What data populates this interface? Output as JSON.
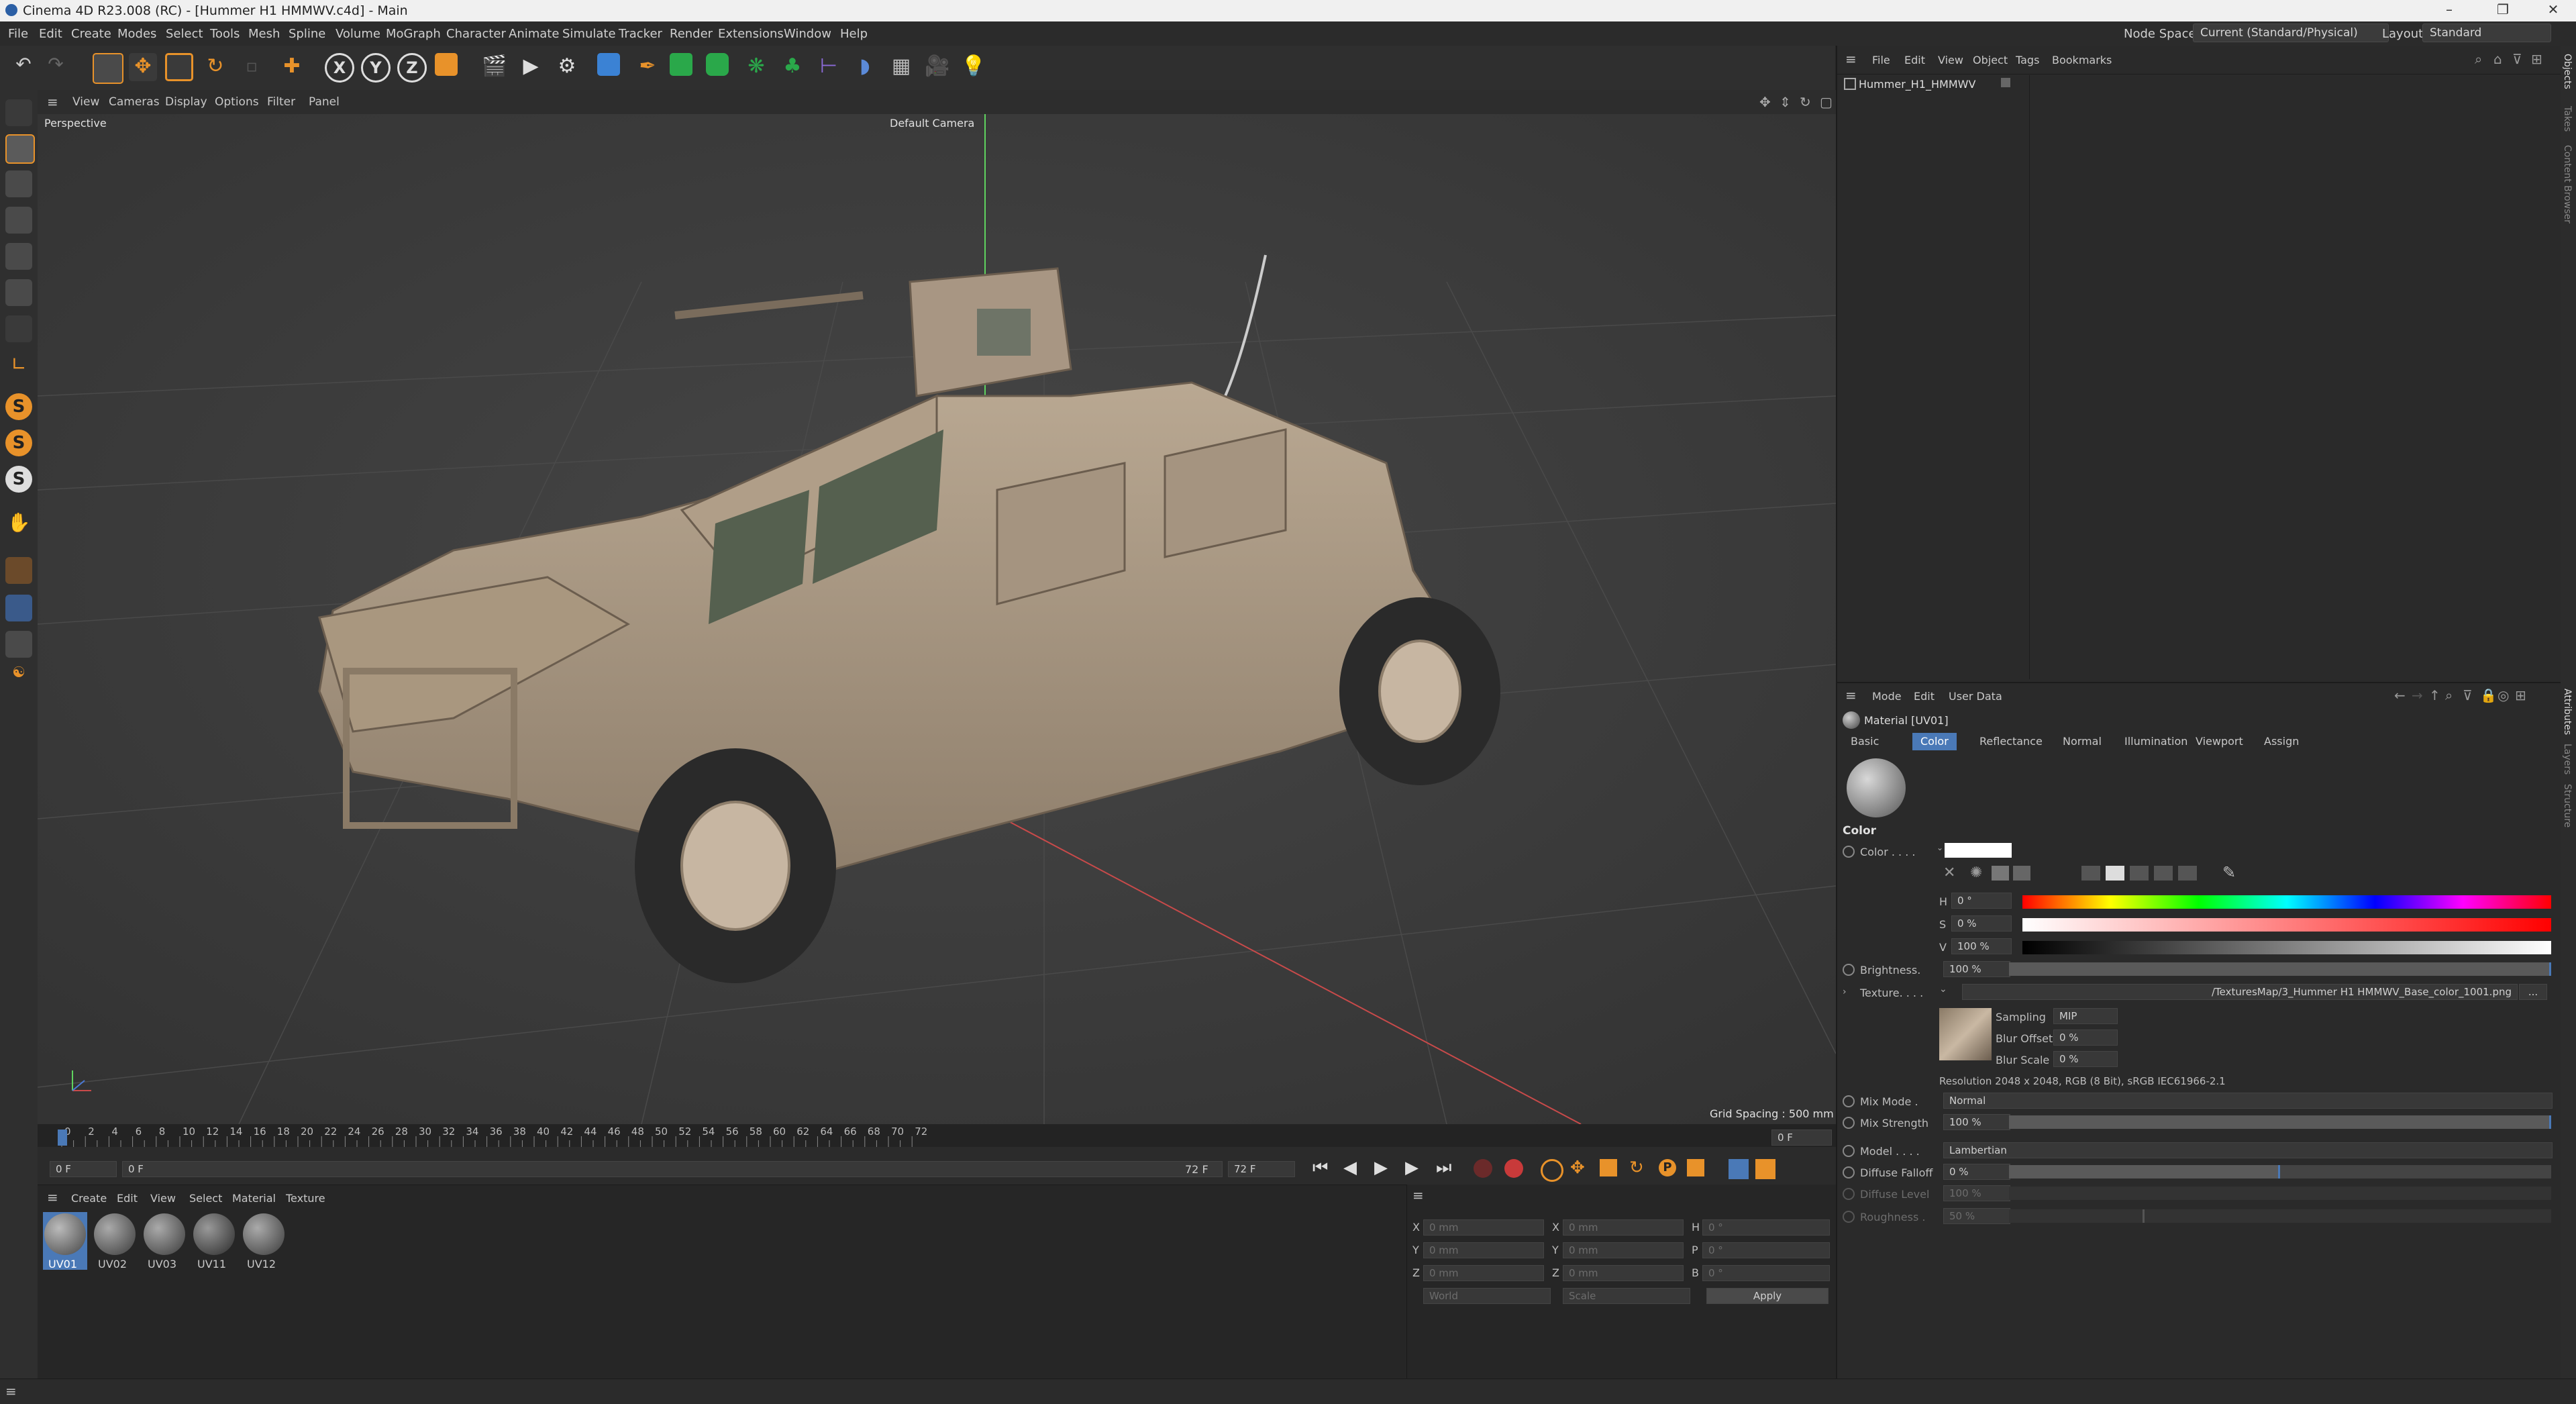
{
  "window": {
    "title": "Cinema 4D R23.008 (RC) - [Hummer H1 HMMWV.c4d] - Main"
  },
  "menu": [
    "File",
    "Edit",
    "Create",
    "Modes",
    "Select",
    "Tools",
    "Mesh",
    "Spline",
    "Volume",
    "MoGraph",
    "Character",
    "Animate",
    "Simulate",
    "Tracker",
    "Render",
    "Extensions",
    "Window",
    "Help"
  ],
  "header_right": {
    "node_space_label": "Node Space:",
    "node_space_value": "Current (Standard/Physical)",
    "layout_label": "Layout:",
    "layout_value": "Standard"
  },
  "toolbar": {
    "x": "X",
    "y": "Y",
    "z": "Z"
  },
  "viewport": {
    "menu": [
      "View",
      "Cameras",
      "Display",
      "Options",
      "Filter",
      "Panel"
    ],
    "label": "Perspective",
    "camera": "Default Camera",
    "grid_spacing": "Grid Spacing : 500 mm"
  },
  "timeline": {
    "ticks": [
      "0",
      "2",
      "4",
      "6",
      "8",
      "10",
      "12",
      "14",
      "16",
      "18",
      "20",
      "22",
      "24",
      "26",
      "28",
      "30",
      "32",
      "34",
      "36",
      "38",
      "40",
      "42",
      "44",
      "46",
      "48",
      "50",
      "52",
      "54",
      "56",
      "58",
      "60",
      "62",
      "64",
      "66",
      "68",
      "70",
      "72"
    ],
    "current_frame_right": "0 F",
    "start_field": "0 F",
    "start_field2": "0 F",
    "end_label": "72 F",
    "end_field": "72 F"
  },
  "material_manager": {
    "menu": [
      "Create",
      "Edit",
      "View",
      "Select",
      "Material",
      "Texture"
    ],
    "materials": [
      "UV01",
      "UV02",
      "UV03",
      "UV11",
      "UV12"
    ]
  },
  "coordinates": {
    "rows": [
      {
        "a": "X",
        "av": "0 mm",
        "b": "X",
        "bv": "0 mm",
        "c": "H",
        "cv": "0 °"
      },
      {
        "a": "Y",
        "av": "0 mm",
        "b": "Y",
        "bv": "0 mm",
        "c": "P",
        "cv": "0 °"
      },
      {
        "a": "Z",
        "av": "0 mm",
        "b": "Z",
        "bv": "0 mm",
        "c": "B",
        "cv": "0 °"
      }
    ],
    "mode": "World",
    "scale": "Scale",
    "apply": "Apply"
  },
  "object_manager": {
    "menu": [
      "File",
      "Edit",
      "View",
      "Object",
      "Tags",
      "Bookmarks"
    ],
    "object": "Hummer_H1_HMMWV"
  },
  "attributes": {
    "menu": [
      "Mode",
      "Edit",
      "User Data"
    ],
    "material_title": "Material [UV01]",
    "tabs": [
      "Basic",
      "Color",
      "Reflectance",
      "Normal",
      "Illumination",
      "Viewport",
      "Assign"
    ],
    "active_tab": "Color",
    "section": "Color",
    "color_label": "Color . . . .",
    "h_label": "H",
    "h_value": "0 °",
    "s_label": "S",
    "s_value": "0 %",
    "v_label": "V",
    "v_value": "100 %",
    "brightness_label": "Brightness.",
    "brightness_value": "100 %",
    "texture_label": "Texture. . . .",
    "texture_path": "/TexturesMap/3_Hummer H1 HMMWV_Base_color_1001.png",
    "texture_btn": "...",
    "sampling_label": "Sampling",
    "sampling_value": "MIP",
    "blur_offset_label": "Blur Offset",
    "blur_offset_value": "0 %",
    "blur_scale_label": "Blur Scale",
    "blur_scale_value": "0 %",
    "resolution": "Resolution 2048 x 2048, RGB (8 Bit), sRGB IEC61966-2.1",
    "mix_mode_label": "Mix Mode .",
    "mix_mode_value": "Normal",
    "mix_strength_label": "Mix Strength",
    "mix_strength_value": "100 %",
    "model_label": "Model . . . .",
    "model_value": "Lambertian",
    "diffuse_falloff_label": "Diffuse Falloff",
    "diffuse_falloff_value": "0 %",
    "diffuse_level_label": "Diffuse Level",
    "diffuse_level_value": "100 %",
    "roughness_label": "Roughness .",
    "roughness_value": "50 %"
  },
  "side_tabs_top": [
    "Objects",
    "Takes",
    "Content Browser"
  ],
  "side_tabs_bottom": [
    "Attributes",
    "Layers",
    "Structure"
  ],
  "colors": {
    "accent": "#4a79b7",
    "gray_bg": "#262626",
    "viewport": "#3a3a3a",
    "orange": "#e8922a"
  }
}
